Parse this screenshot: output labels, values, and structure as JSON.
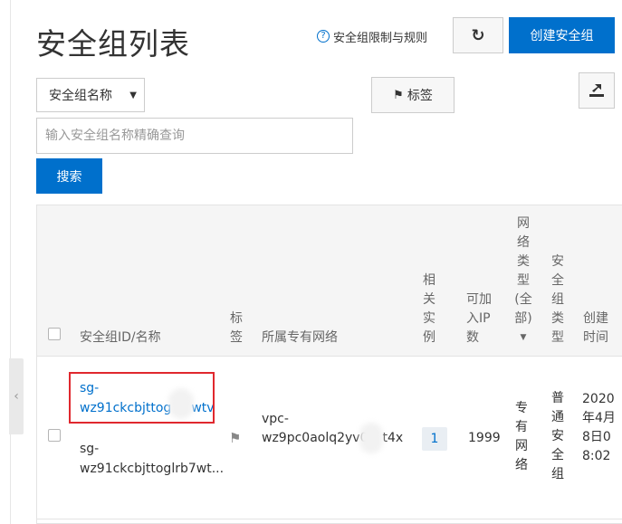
{
  "page": {
    "title": "安全组列表",
    "help_link": "安全组限制与规则",
    "create_button": "创建安全组"
  },
  "filter": {
    "select_value": "安全组名称",
    "tag_button": "标签",
    "search_placeholder": "输入安全组名称精确查询",
    "search_button": "搜索"
  },
  "table": {
    "headers": {
      "id_name": "安全组ID/名称",
      "tag": "标签",
      "vpc": "所属专有网络",
      "instances": "相关实例",
      "ip_count": "可加入IP数",
      "network_type": "网络类型(全部)",
      "group_type": "安全组类型",
      "created": "创建时间"
    },
    "rows": [
      {
        "id_line1": "sg-",
        "id_line2": "wz91ckcbjttog",
        "id_line2_tail": "wtv",
        "name_line1": "sg-",
        "name_line2": "wz91ckcbjttoglrb7wt...",
        "vpc_line1": "vpc-",
        "vpc_line2": "wz9pc0aolq2yv0",
        "vpc_tail": "t4x",
        "instances": "1",
        "ip_count": "1999",
        "network_type": "专有网络",
        "group_type": "普通安全组",
        "created": "2020年4月8日08:02"
      }
    ]
  },
  "colors": {
    "primary": "#0070cc",
    "highlight": "#e0282e"
  },
  "icons": {
    "help": "question-circle-icon",
    "refresh": "refresh-icon",
    "tag": "tag-icon",
    "export": "export-icon",
    "caret": "caret-down-icon",
    "collapse": "chevron-left-icon"
  }
}
